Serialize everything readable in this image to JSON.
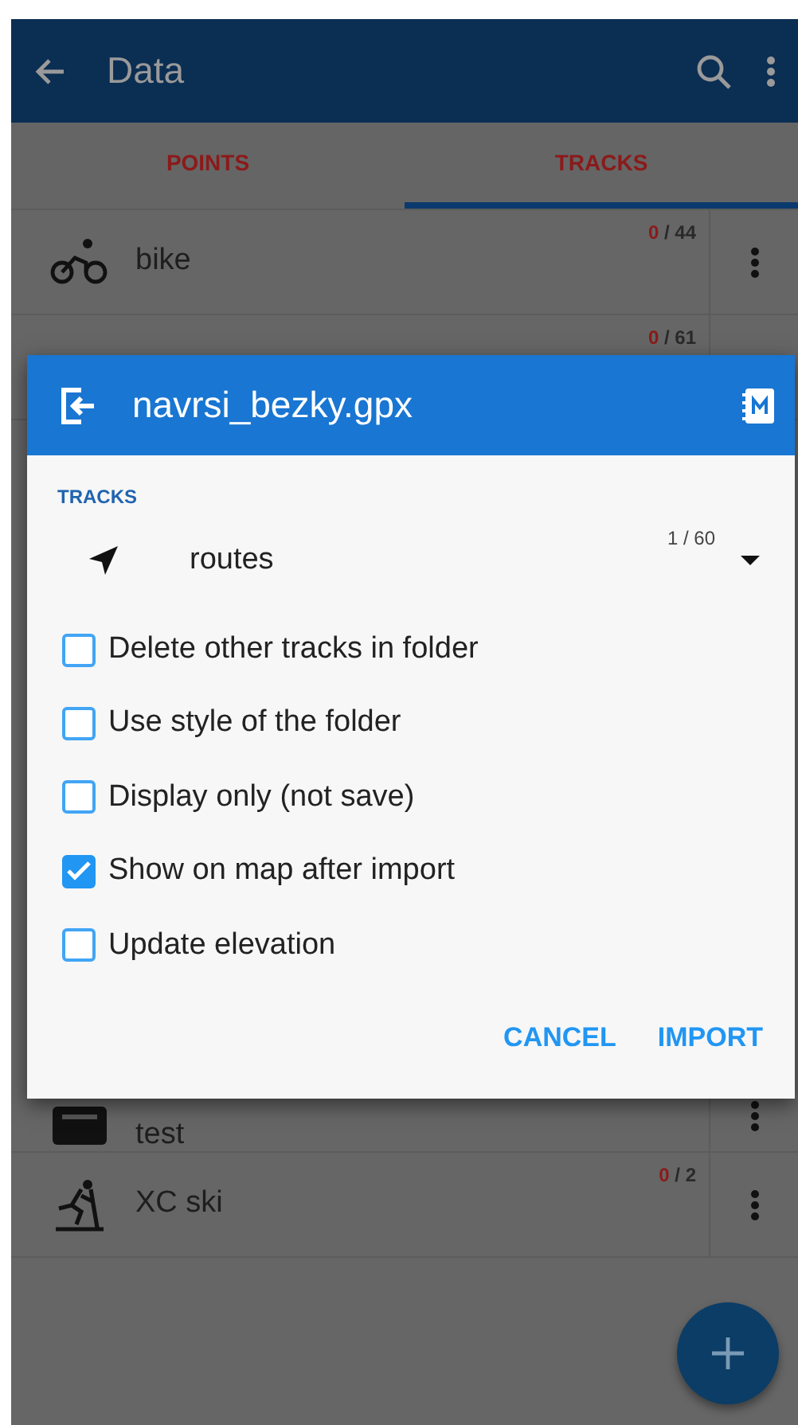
{
  "app_bar": {
    "title": "Data"
  },
  "tabs": [
    {
      "label": "POINTS",
      "selected": false
    },
    {
      "label": "TRACKS",
      "selected": true
    }
  ],
  "folders": [
    {
      "name": "bike",
      "count": "0",
      "total": "/ 44"
    },
    {
      "count": "0",
      "total": "/ 61"
    },
    {
      "name": "test"
    },
    {
      "name": "XC ski",
      "count": "0",
      "total": "/ 2"
    }
  ],
  "dialog": {
    "title": "navrsi_bezky.gpx",
    "section": "TRACKS",
    "folder": {
      "name": "routes",
      "count": "1 / 60"
    },
    "options": [
      {
        "label": "Delete other tracks in folder",
        "checked": false
      },
      {
        "label": "Use style of the folder",
        "checked": false
      },
      {
        "label": "Display only (not save)",
        "checked": false
      },
      {
        "label": "Show on map after import",
        "checked": true
      },
      {
        "label": "Update elevation",
        "checked": false
      }
    ],
    "buttons": [
      "CANCEL",
      "IMPORT"
    ]
  }
}
